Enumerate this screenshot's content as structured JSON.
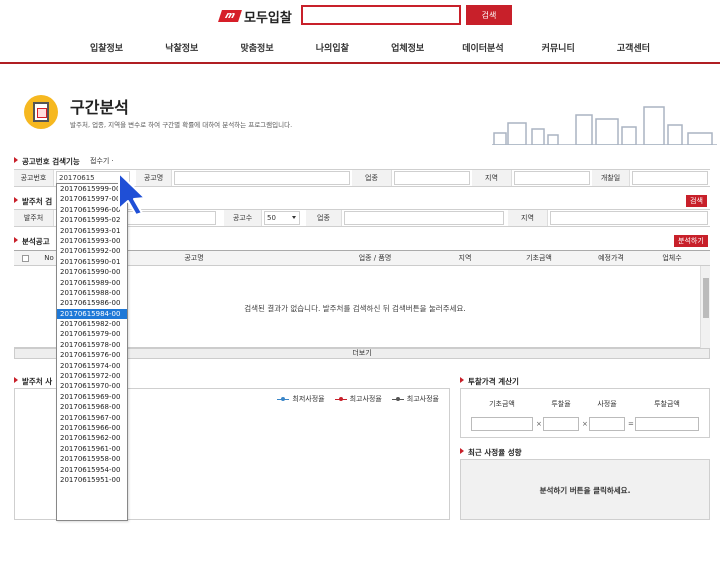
{
  "header": {
    "logo_mark": "m",
    "logo_text": "모두입찰",
    "search_placeholder": "",
    "search_button": "검색",
    "nav": [
      "입찰정보",
      "낙찰정보",
      "맞춤정보",
      "나의입찰",
      "업체정보",
      "데이터분석",
      "커뮤니티",
      "고객센터"
    ]
  },
  "page": {
    "title": "구간분석",
    "description": "발주처, 업종, 지역을 변수로 하여 구간별 확률에 대하여 분석하는 프로그램입니다."
  },
  "announce_section": {
    "title": "공고번호 검색기능",
    "collapse_label": "접수기 ·",
    "labels": {
      "number": "공고번호",
      "name": "공고명",
      "industry": "업종",
      "region": "지역",
      "open_date": "개찰일"
    },
    "number_value": "20170615"
  },
  "orderer_section": {
    "title": "발주처 검",
    "search_button": "검색",
    "labels": {
      "orderer": "발주처",
      "count": "공고수",
      "industry": "업종",
      "region": "지역"
    },
    "count_value": "50"
  },
  "results_section": {
    "title": "분석공고",
    "analyze_button": "분석하기",
    "columns": [
      "No",
      "공고명",
      "업종 / 품명",
      "지역",
      "기초금액",
      "예정가격",
      "업체수"
    ],
    "empty_message": "검색된 결과가 없습니다. 발주처를 검색하신 뒤 검색버튼을 눌러주세요.",
    "more_label": "더보기"
  },
  "chart_section": {
    "title": "발주처 사",
    "legend": [
      "최저사정율",
      "최고사정율",
      "최고사정율"
    ],
    "legend_colors": [
      "#3a86c8",
      "#c8202a",
      "#555555"
    ]
  },
  "calc_section": {
    "title": "투찰가격 계산기",
    "labels": [
      "기초금액",
      "투찰율",
      "사정율",
      "투찰금액"
    ],
    "ops": [
      "×",
      "×",
      "="
    ]
  },
  "trend_section": {
    "title": "최근 사정율 성향",
    "message": "분석하기 버튼을 클릭하세요."
  },
  "dropdown": {
    "items": [
      "20170615999-00",
      "20170615997-00",
      "20170615996-00",
      "20170615995-02",
      "20170615993-01",
      "20170615993-00",
      "20170615992-00",
      "20170615990-01",
      "20170615990-00",
      "20170615989-00",
      "20170615988-00",
      "20170615986-00",
      "20170615984-00",
      "20170615982-00",
      "20170615979-00",
      "20170615978-00",
      "20170615976-00",
      "20170615974-00",
      "20170615972-00",
      "20170615970-00",
      "20170615969-00",
      "20170615968-00",
      "20170615967-00",
      "20170615966-00",
      "20170615962-00",
      "20170615961-00",
      "20170615958-00",
      "20170615954-00",
      "20170615951-00"
    ],
    "selected": "20170615984-00"
  },
  "colors": {
    "brand": "#c8202a",
    "selected": "#1e78d7",
    "cursor": "#1f4fd6"
  }
}
